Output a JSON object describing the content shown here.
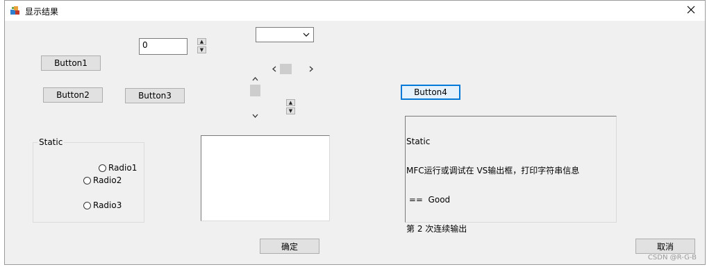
{
  "window": {
    "title": "显示结果"
  },
  "icons": {
    "app": "app-icon",
    "close": "close-icon"
  },
  "buttons": {
    "button1": "Button1",
    "button2": "Button2",
    "button3": "Button3",
    "button4": "Button4",
    "ok": "确定",
    "cancel": "取消"
  },
  "edit": {
    "value": "0"
  },
  "combo": {
    "selected": ""
  },
  "group": {
    "label": "Static"
  },
  "radios": [
    "Radio1",
    "Radio2",
    "Radio3"
  ],
  "output": {
    "lines": [
      "Static",
      "MFC运行或调试在 VS输出框，打印字符串信息",
      " ==  Good",
      "第 2 次连续输出"
    ]
  },
  "watermark": "CSDN @R-G-B",
  "colors": {
    "accent": "#0078d7",
    "dialog_bg": "#f0f0f0"
  }
}
